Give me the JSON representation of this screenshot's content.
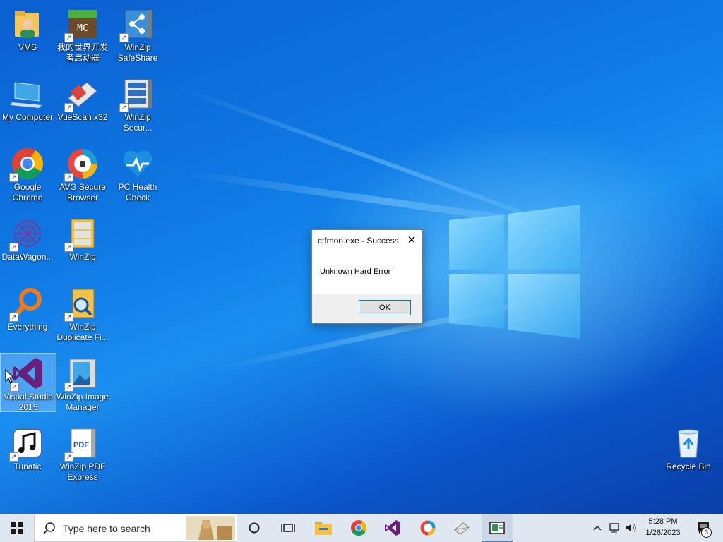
{
  "desktop": {
    "icons": [
      {
        "id": "vms",
        "label": "VMS",
        "shortcut": false
      },
      {
        "id": "minecraft",
        "label": "我的世界开发者启动器",
        "shortcut": true,
        "badge": "MC"
      },
      {
        "id": "winzip-safeshare",
        "label": "WinZip SafeShare",
        "shortcut": true
      },
      {
        "id": "my-computer",
        "label": "My Computer",
        "shortcut": false
      },
      {
        "id": "vuescan",
        "label": "VueScan x32",
        "shortcut": true
      },
      {
        "id": "winzip-secure",
        "label": "WinZip Secur...",
        "shortcut": true
      },
      {
        "id": "google-chrome",
        "label": "Google Chrome",
        "shortcut": true
      },
      {
        "id": "avg-browser",
        "label": "AVG Secure Browser",
        "shortcut": true
      },
      {
        "id": "pc-health",
        "label": "PC Health Check",
        "shortcut": false
      },
      {
        "id": "datawagon",
        "label": "DataWagon...",
        "shortcut": true
      },
      {
        "id": "winzip",
        "label": "WinZip",
        "shortcut": true
      },
      {
        "id": "everything",
        "label": "Everything",
        "shortcut": true
      },
      {
        "id": "winzip-duplicate",
        "label": "WinZip Duplicate Fi...",
        "shortcut": true
      },
      {
        "id": "visual-studio",
        "label": "Visual Studio 2015",
        "shortcut": true,
        "selected": true
      },
      {
        "id": "winzip-image",
        "label": "WinZip Image Manager",
        "shortcut": true
      },
      {
        "id": "tunatic",
        "label": "Tunatic",
        "shortcut": true
      },
      {
        "id": "winzip-pdf",
        "label": "WinZip PDF Express",
        "shortcut": true,
        "badge": "PDF"
      },
      {
        "id": "recycle-bin",
        "label": "Recycle Bin",
        "shortcut": false
      }
    ]
  },
  "dialog": {
    "title": "ctfmon.exe - Success",
    "message": "Unknown Hard Error",
    "ok_label": "OK",
    "close_glyph": "✕"
  },
  "taskbar": {
    "search_placeholder": "Type here to search",
    "pinned": [
      "start-icon",
      "search-icon",
      "cortana-icon",
      "task-view-icon",
      "file-explorer-icon",
      "chrome-icon",
      "visual-studio-icon",
      "avg-browser-icon",
      "vuescan-icon",
      "app-window-icon"
    ],
    "tray": {
      "time": "5:28 PM",
      "date": "1/26/2023",
      "notification_count": "3"
    }
  },
  "colors": {
    "accent": "#0078d7",
    "taskbar": "#dfe7f1",
    "vs_purple": "#68217a",
    "desktop_blue": "#0e78e3"
  }
}
